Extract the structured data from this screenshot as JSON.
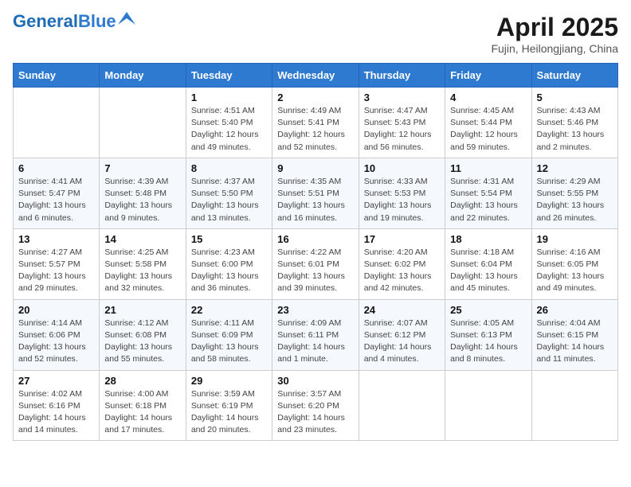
{
  "header": {
    "logo_general": "General",
    "logo_blue": "Blue",
    "month_title": "April 2025",
    "subtitle": "Fujin, Heilongjiang, China"
  },
  "days_of_week": [
    "Sunday",
    "Monday",
    "Tuesday",
    "Wednesday",
    "Thursday",
    "Friday",
    "Saturday"
  ],
  "weeks": [
    [
      {
        "day": "",
        "detail": ""
      },
      {
        "day": "",
        "detail": ""
      },
      {
        "day": "1",
        "detail": "Sunrise: 4:51 AM\nSunset: 5:40 PM\nDaylight: 12 hours and 49 minutes."
      },
      {
        "day": "2",
        "detail": "Sunrise: 4:49 AM\nSunset: 5:41 PM\nDaylight: 12 hours and 52 minutes."
      },
      {
        "day": "3",
        "detail": "Sunrise: 4:47 AM\nSunset: 5:43 PM\nDaylight: 12 hours and 56 minutes."
      },
      {
        "day": "4",
        "detail": "Sunrise: 4:45 AM\nSunset: 5:44 PM\nDaylight: 12 hours and 59 minutes."
      },
      {
        "day": "5",
        "detail": "Sunrise: 4:43 AM\nSunset: 5:46 PM\nDaylight: 13 hours and 2 minutes."
      }
    ],
    [
      {
        "day": "6",
        "detail": "Sunrise: 4:41 AM\nSunset: 5:47 PM\nDaylight: 13 hours and 6 minutes."
      },
      {
        "day": "7",
        "detail": "Sunrise: 4:39 AM\nSunset: 5:48 PM\nDaylight: 13 hours and 9 minutes."
      },
      {
        "day": "8",
        "detail": "Sunrise: 4:37 AM\nSunset: 5:50 PM\nDaylight: 13 hours and 13 minutes."
      },
      {
        "day": "9",
        "detail": "Sunrise: 4:35 AM\nSunset: 5:51 PM\nDaylight: 13 hours and 16 minutes."
      },
      {
        "day": "10",
        "detail": "Sunrise: 4:33 AM\nSunset: 5:53 PM\nDaylight: 13 hours and 19 minutes."
      },
      {
        "day": "11",
        "detail": "Sunrise: 4:31 AM\nSunset: 5:54 PM\nDaylight: 13 hours and 22 minutes."
      },
      {
        "day": "12",
        "detail": "Sunrise: 4:29 AM\nSunset: 5:55 PM\nDaylight: 13 hours and 26 minutes."
      }
    ],
    [
      {
        "day": "13",
        "detail": "Sunrise: 4:27 AM\nSunset: 5:57 PM\nDaylight: 13 hours and 29 minutes."
      },
      {
        "day": "14",
        "detail": "Sunrise: 4:25 AM\nSunset: 5:58 PM\nDaylight: 13 hours and 32 minutes."
      },
      {
        "day": "15",
        "detail": "Sunrise: 4:23 AM\nSunset: 6:00 PM\nDaylight: 13 hours and 36 minutes."
      },
      {
        "day": "16",
        "detail": "Sunrise: 4:22 AM\nSunset: 6:01 PM\nDaylight: 13 hours and 39 minutes."
      },
      {
        "day": "17",
        "detail": "Sunrise: 4:20 AM\nSunset: 6:02 PM\nDaylight: 13 hours and 42 minutes."
      },
      {
        "day": "18",
        "detail": "Sunrise: 4:18 AM\nSunset: 6:04 PM\nDaylight: 13 hours and 45 minutes."
      },
      {
        "day": "19",
        "detail": "Sunrise: 4:16 AM\nSunset: 6:05 PM\nDaylight: 13 hours and 49 minutes."
      }
    ],
    [
      {
        "day": "20",
        "detail": "Sunrise: 4:14 AM\nSunset: 6:06 PM\nDaylight: 13 hours and 52 minutes."
      },
      {
        "day": "21",
        "detail": "Sunrise: 4:12 AM\nSunset: 6:08 PM\nDaylight: 13 hours and 55 minutes."
      },
      {
        "day": "22",
        "detail": "Sunrise: 4:11 AM\nSunset: 6:09 PM\nDaylight: 13 hours and 58 minutes."
      },
      {
        "day": "23",
        "detail": "Sunrise: 4:09 AM\nSunset: 6:11 PM\nDaylight: 14 hours and 1 minute."
      },
      {
        "day": "24",
        "detail": "Sunrise: 4:07 AM\nSunset: 6:12 PM\nDaylight: 14 hours and 4 minutes."
      },
      {
        "day": "25",
        "detail": "Sunrise: 4:05 AM\nSunset: 6:13 PM\nDaylight: 14 hours and 8 minutes."
      },
      {
        "day": "26",
        "detail": "Sunrise: 4:04 AM\nSunset: 6:15 PM\nDaylight: 14 hours and 11 minutes."
      }
    ],
    [
      {
        "day": "27",
        "detail": "Sunrise: 4:02 AM\nSunset: 6:16 PM\nDaylight: 14 hours and 14 minutes."
      },
      {
        "day": "28",
        "detail": "Sunrise: 4:00 AM\nSunset: 6:18 PM\nDaylight: 14 hours and 17 minutes."
      },
      {
        "day": "29",
        "detail": "Sunrise: 3:59 AM\nSunset: 6:19 PM\nDaylight: 14 hours and 20 minutes."
      },
      {
        "day": "30",
        "detail": "Sunrise: 3:57 AM\nSunset: 6:20 PM\nDaylight: 14 hours and 23 minutes."
      },
      {
        "day": "",
        "detail": ""
      },
      {
        "day": "",
        "detail": ""
      },
      {
        "day": "",
        "detail": ""
      }
    ]
  ]
}
